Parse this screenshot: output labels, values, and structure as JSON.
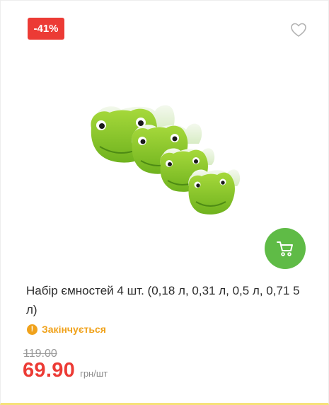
{
  "product": {
    "discount_badge": "-41%",
    "name": "Набір ємностей 4 шт. (0,18 л, 0,31 л, 0,5 л, 0,71 5 л)",
    "stock_status": "Закінчується",
    "old_price": "119.00",
    "current_price": "69.90",
    "price_unit": "грн/шт",
    "image_alt": "frog-shaped-containers-image"
  },
  "icons": {
    "wishlist": "heart-icon",
    "cart": "cart-icon",
    "stock": "exclamation-icon"
  },
  "colors": {
    "discount": "#ec3b35",
    "cart_button": "#5fbb46",
    "stock_warning": "#f0a21b",
    "price": "#ec3b35"
  }
}
